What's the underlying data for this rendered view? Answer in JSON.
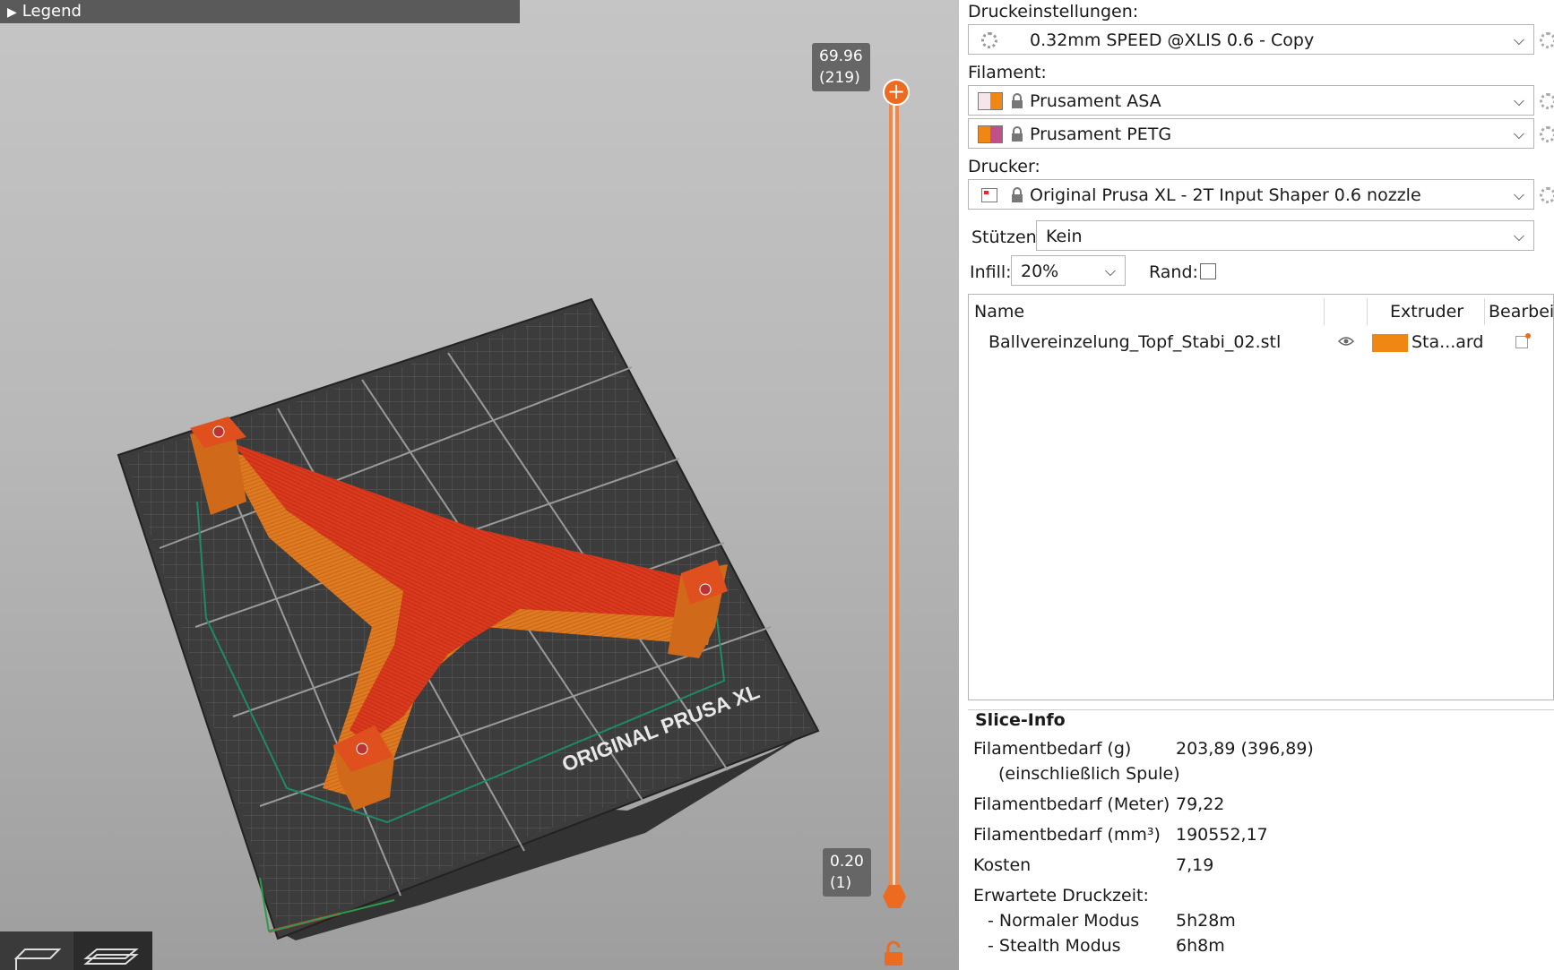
{
  "viewport": {
    "legend_label": "Legend",
    "bed_label": "ORIGINAL PRUSA XL",
    "slider": {
      "top_value": "69.96",
      "top_layer": "(219)",
      "bottom_value": "0.20",
      "bottom_layer": "(1)"
    }
  },
  "panel": {
    "print_settings": {
      "label": "Druckeinstellungen:",
      "value": "0.32mm SPEED @XLIS 0.6 - Copy"
    },
    "filament": {
      "label": "Filament:",
      "items": [
        {
          "name": "Prusament ASA",
          "color_a": "#f4e6ea",
          "color_b": "#f08613"
        },
        {
          "name": "Prusament PETG",
          "color_a": "#f08613",
          "color_b": "#c0508a"
        }
      ]
    },
    "printer": {
      "label": "Drucker:",
      "value": "Original Prusa XL - 2T Input Shaper 0.6 nozzle"
    },
    "supports": {
      "label": "Stützen:",
      "value": "Kein"
    },
    "infill": {
      "label": "Infill:",
      "value": "20%"
    },
    "brim": {
      "label": "Rand:",
      "checked": false
    },
    "object_list": {
      "columns": {
        "name": "Name",
        "extruder": "Extruder",
        "edit": "Bearbei..."
      },
      "rows": [
        {
          "name": "Ballvereinzelung_Topf_Stabi_02.stl",
          "extruder": "Sta...ard",
          "extruder_color": "#f08613"
        }
      ]
    },
    "slice_info": {
      "title": "Slice-Info",
      "rows": [
        {
          "key": "Filamentbedarf (g)",
          "value": "203,89 (396,89)"
        },
        {
          "key": "(einschließlich Spule)",
          "value": ""
        },
        {
          "key": "Filamentbedarf (Meter)",
          "value": "79,22"
        },
        {
          "key": "Filamentbedarf (mm³)",
          "value": "190552,17"
        },
        {
          "key": "Kosten",
          "value": "7,19"
        },
        {
          "key": "Erwartete Druckzeit:",
          "value": ""
        },
        {
          "key": "- Normaler Modus",
          "value": "5h28m"
        },
        {
          "key": "- Stealth Modus",
          "value": "6h8m"
        }
      ]
    }
  },
  "colors": {
    "accent": "#ed6b21",
    "part_top": "#d9391c",
    "part_side": "#e07a1e"
  }
}
